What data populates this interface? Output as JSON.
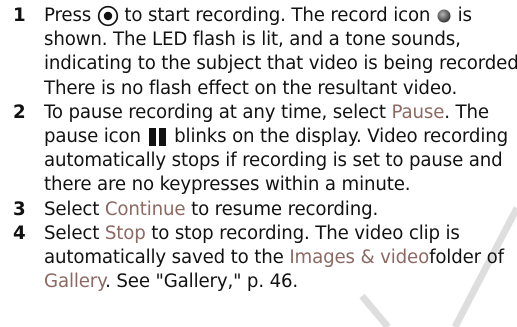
{
  "watermark": {
    "color": "#dedede"
  },
  "steps": [
    {
      "number": "1",
      "lines": {
        "l1a": "Press",
        "l1b": "to start recording. The record icon",
        "l1c": "is",
        "l2": "shown. The LED flash is lit, and a tone sounds,",
        "l3": "indicating to the subject that video is being recorded.",
        "l4": "There is no flash effect on the resultant video."
      },
      "icons": [
        "record-key-icon",
        "record-dot-icon"
      ]
    },
    {
      "number": "2",
      "lines": {
        "l1a": "To pause recording at any time, select",
        "l1ui": "Pause",
        "l1b": ". The",
        "l2a": "pause icon",
        "l2b": "blinks on the display. Video recording",
        "l3": "automatically stops if recording is set to pause and",
        "l4": "there are no keypresses within a minute."
      },
      "icons": [
        "pause-icon"
      ]
    },
    {
      "number": "3",
      "lines": {
        "l1a": "Select",
        "l1ui": "Continue",
        "l1b": "to resume recording."
      }
    },
    {
      "number": "4",
      "lines": {
        "l1a": "Select",
        "l1ui": "Stop",
        "l1b": "to stop recording. The video clip is",
        "l2a": "automatically saved to the",
        "l2ui": "Images & video",
        "l2b": "folder of",
        "l3ui": "Gallery",
        "l3b": ". See \"Gallery,\" p. 46."
      }
    }
  ],
  "colors": {
    "text": "#111111",
    "ui_term": "#8c6a63"
  }
}
